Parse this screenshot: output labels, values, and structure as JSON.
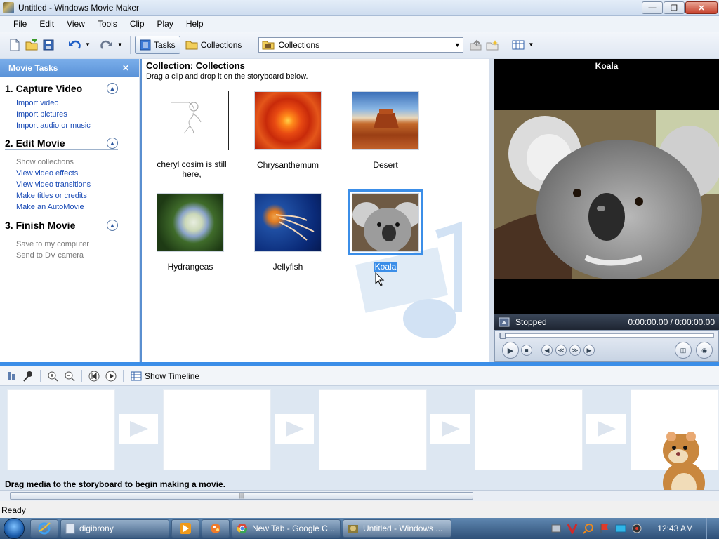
{
  "window": {
    "title": "Untitled - Windows Movie Maker"
  },
  "menu": [
    "File",
    "Edit",
    "View",
    "Tools",
    "Clip",
    "Play",
    "Help"
  ],
  "toolbar": {
    "tasks_label": "Tasks",
    "collections_label": "Collections",
    "combo_value": "Collections"
  },
  "tasks": {
    "header": "Movie Tasks",
    "sections": [
      {
        "title": "1. Capture Video",
        "links": [
          {
            "label": "Import video",
            "enabled": true
          },
          {
            "label": "Import pictures",
            "enabled": true
          },
          {
            "label": "Import audio or music",
            "enabled": true
          }
        ]
      },
      {
        "title": "2. Edit Movie",
        "links": [
          {
            "label": "Show collections",
            "enabled": false
          },
          {
            "label": "View video effects",
            "enabled": true
          },
          {
            "label": "View video transitions",
            "enabled": true
          },
          {
            "label": "Make titles or credits",
            "enabled": true
          },
          {
            "label": "Make an AutoMovie",
            "enabled": true
          }
        ]
      },
      {
        "title": "3. Finish Movie",
        "links": [
          {
            "label": "Save to my computer",
            "enabled": false
          },
          {
            "label": "Send to DV camera",
            "enabled": false
          }
        ]
      }
    ]
  },
  "collection": {
    "title": "Collection: Collections",
    "subtitle": "Drag a clip and drop it on the storyboard below.",
    "items": [
      {
        "label": "cheryl cosim is still here,"
      },
      {
        "label": "Chrysanthemum"
      },
      {
        "label": "Desert"
      },
      {
        "label": "Hydrangeas"
      },
      {
        "label": "Jellyfish"
      },
      {
        "label": "Koala",
        "selected": true
      }
    ]
  },
  "preview": {
    "title": "Koala",
    "status": "Stopped",
    "time": "0:00:00.00 / 0:00:00.00"
  },
  "storyboard": {
    "show_timeline_label": "Show Timeline",
    "message": "Drag media to the storyboard to begin making a movie."
  },
  "statusbar": {
    "text": "Ready"
  },
  "taskbar": {
    "tasks": [
      "digibrony",
      "New Tab - Google C...",
      "Untitled - Windows ..."
    ],
    "clock": "12:43 AM"
  }
}
